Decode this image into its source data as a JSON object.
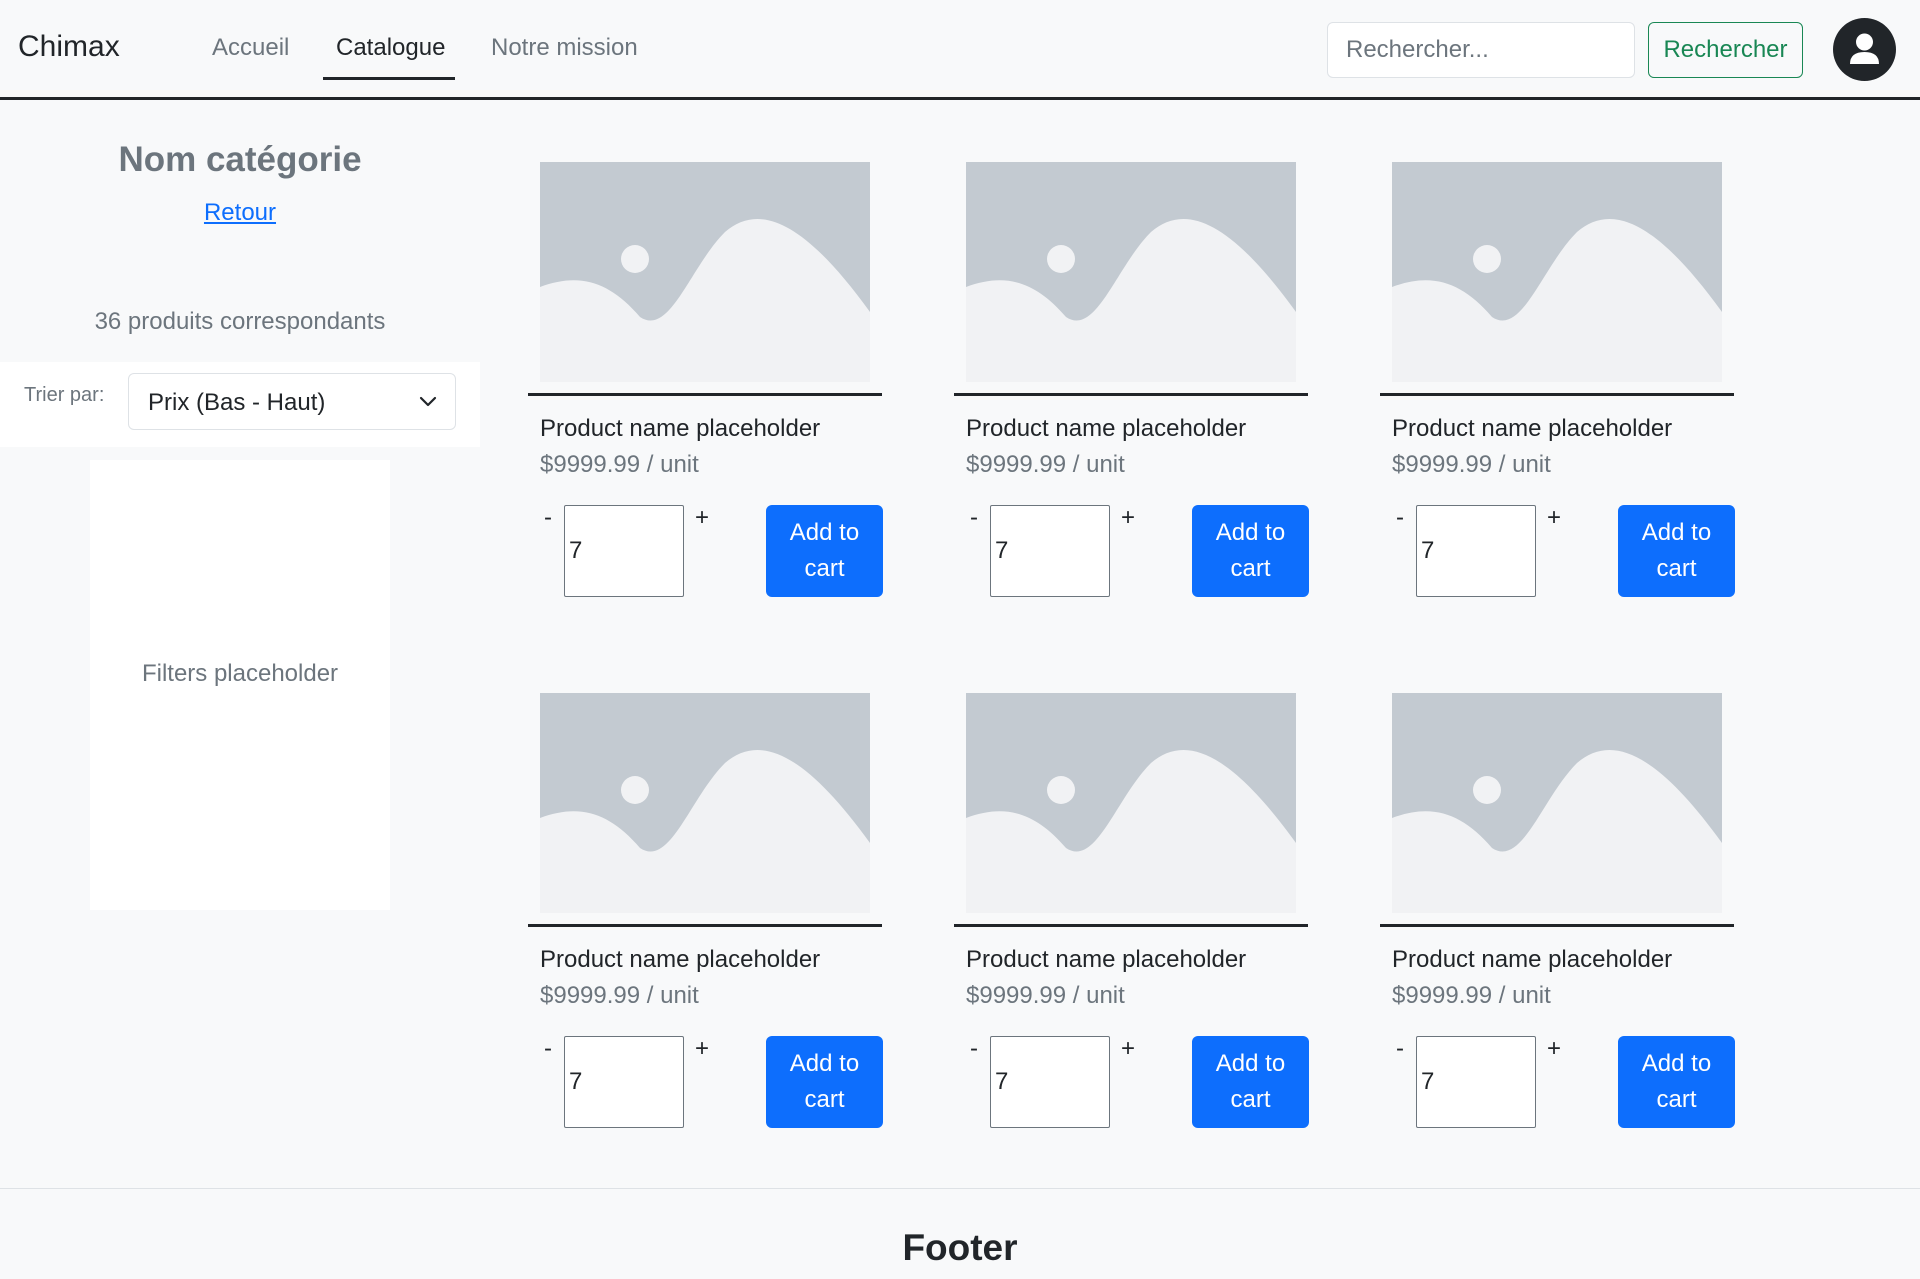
{
  "navbar": {
    "brand": "Chimax",
    "links": [
      {
        "label": "Accueil",
        "active": false
      },
      {
        "label": "Catalogue",
        "active": true
      },
      {
        "label": "Notre mission",
        "active": false
      }
    ],
    "search": {
      "placeholder": "Rechercher...",
      "value": "",
      "button_label": "Rechercher"
    },
    "avatar_icon": "user-icon"
  },
  "sidebar": {
    "category_title": "Nom catégorie",
    "back_link": "Retour",
    "results_count": "36 produits correspondants",
    "sort": {
      "label": "Trier par:",
      "selected": "Prix (Bas - Haut)"
    },
    "filters_placeholder": "Filters placeholder"
  },
  "products": [
    {
      "name": "Product name placeholder",
      "price": "$9999.99 / unit",
      "quantity": "7",
      "minus_label": "-",
      "plus_label": "+",
      "add_label": "Add to cart"
    },
    {
      "name": "Product name placeholder",
      "price": "$9999.99 / unit",
      "quantity": "7",
      "minus_label": "-",
      "plus_label": "+",
      "add_label": "Add to cart"
    },
    {
      "name": "Product name placeholder",
      "price": "$9999.99 / unit",
      "quantity": "7",
      "minus_label": "-",
      "plus_label": "+",
      "add_label": "Add to cart"
    },
    {
      "name": "Product name placeholder",
      "price": "$9999.99 / unit",
      "quantity": "7",
      "minus_label": "-",
      "plus_label": "+",
      "add_label": "Add to cart"
    },
    {
      "name": "Product name placeholder",
      "price": "$9999.99 / unit",
      "quantity": "7",
      "minus_label": "-",
      "plus_label": "+",
      "add_label": "Add to cart"
    },
    {
      "name": "Product name placeholder",
      "price": "$9999.99 / unit",
      "quantity": "7",
      "minus_label": "-",
      "plus_label": "+",
      "add_label": "Add to cart"
    }
  ],
  "footer": {
    "title": "Footer"
  },
  "colors": {
    "background": "#f8f9fa",
    "primary": "#0d6efd",
    "success": "#198754",
    "dark": "#212529",
    "muted": "#6c757d",
    "placeholder_dark": "#c3cad1",
    "placeholder_light": "#f1f2f4"
  }
}
